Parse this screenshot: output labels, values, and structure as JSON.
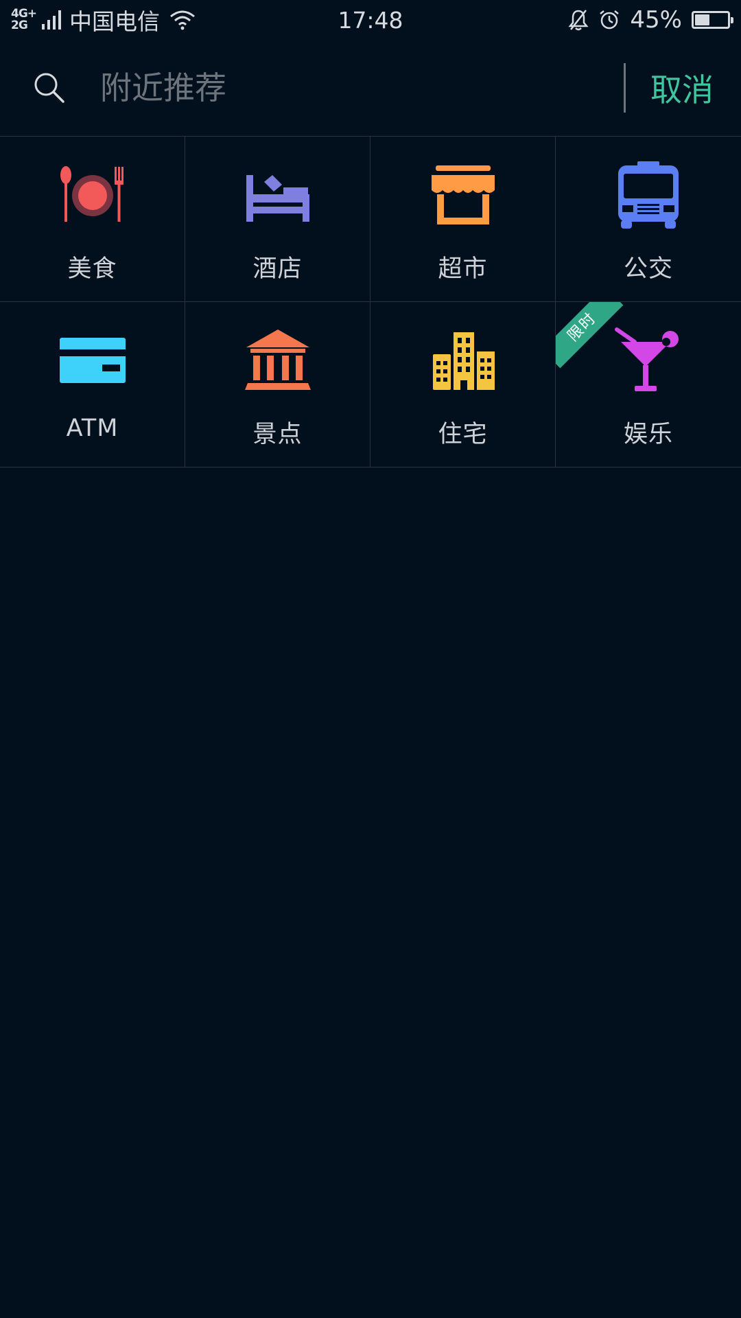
{
  "status_bar": {
    "network_top": "4G+",
    "network_bottom": "2G",
    "carrier": "中国电信",
    "time": "17:48",
    "battery_percent_text": "45%",
    "battery_level": 0.45
  },
  "search": {
    "placeholder": "附近推荐",
    "value": "",
    "cancel_label": "取消"
  },
  "categories": [
    {
      "label": "美食",
      "icon": "dining-icon",
      "color": "#f25a5a"
    },
    {
      "label": "酒店",
      "icon": "hotel-bed-icon",
      "color": "#7f7fe0"
    },
    {
      "label": "超市",
      "icon": "supermarket-icon",
      "color": "#ff9a45"
    },
    {
      "label": "公交",
      "icon": "bus-icon",
      "color": "#5b7ff3"
    },
    {
      "label": "ATM",
      "icon": "bank-card-icon",
      "color": "#3ed2fb"
    },
    {
      "label": "景点",
      "icon": "museum-icon",
      "color": "#f4774e"
    },
    {
      "label": "住宅",
      "icon": "buildings-icon",
      "color": "#f5c542"
    },
    {
      "label": "娱乐",
      "icon": "cocktail-icon",
      "color": "#d347e6",
      "badge": "限时"
    }
  ],
  "colors": {
    "background": "#020f1c",
    "accent": "#3fc69f",
    "badge": "#2fa787",
    "divider": "#2b3541"
  }
}
